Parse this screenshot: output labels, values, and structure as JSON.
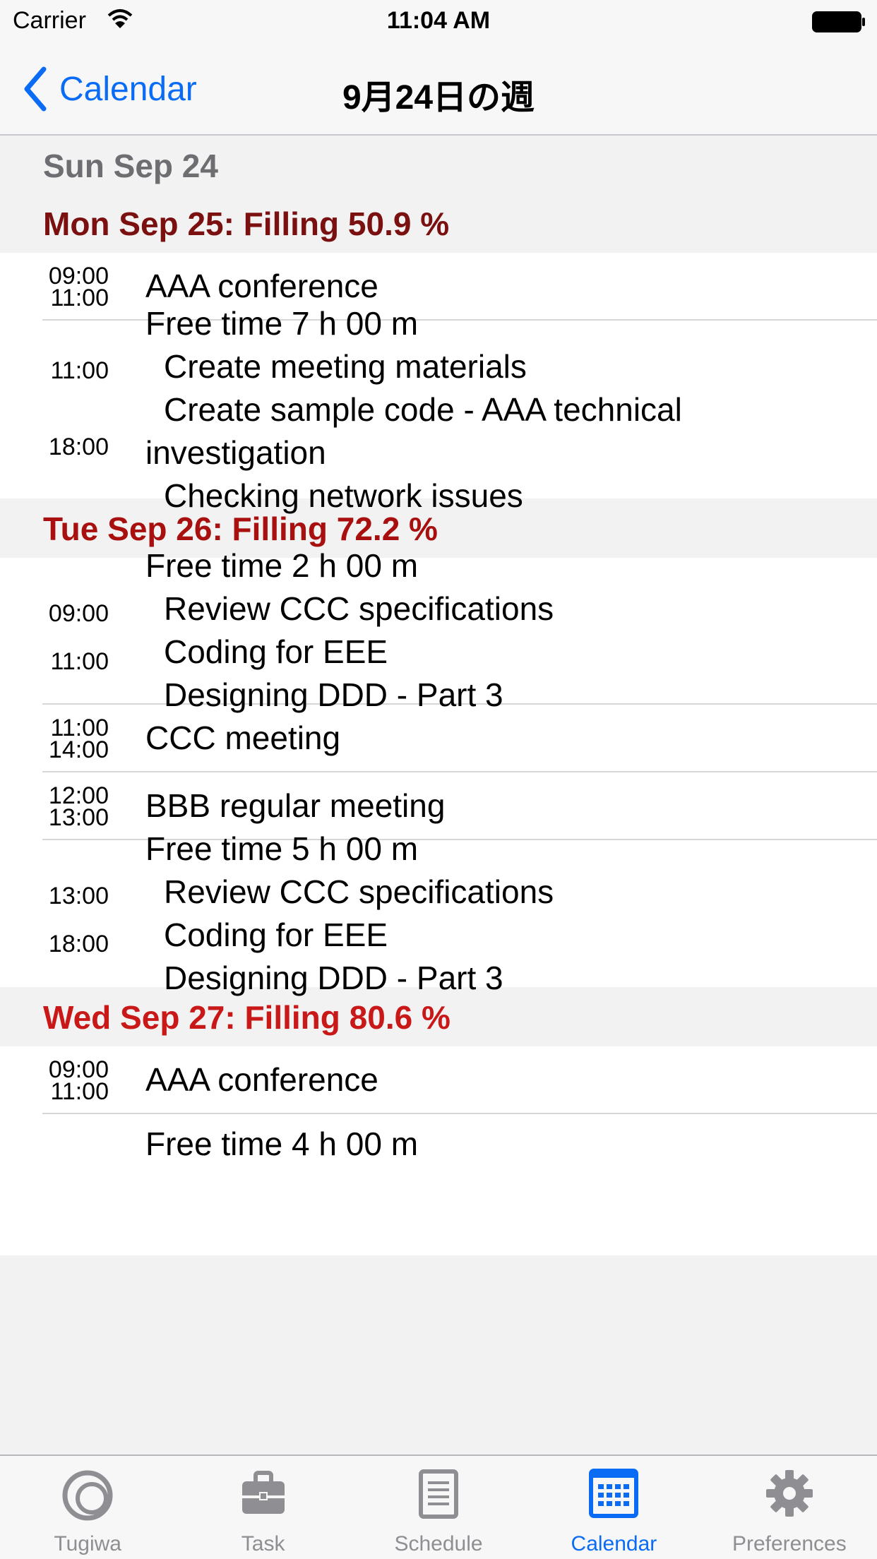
{
  "status_bar": {
    "carrier": "Carrier",
    "time": "11:04 AM"
  },
  "nav": {
    "back_label": "Calendar",
    "title": "9月24日の週"
  },
  "colors": {
    "accent": "#0a6cf5",
    "fill_50": "#7a1010",
    "fill_72": "#a81010",
    "fill_80": "#c81818",
    "plain_day": "#6d6d72"
  },
  "days": [
    {
      "header": "Sun Sep 24",
      "color": "#6d6d72",
      "rows": []
    },
    {
      "header": "Mon Sep 25: Filling 50.9 %",
      "color": "#7a1010",
      "rows": [
        {
          "start": "09:00",
          "end": "11:00",
          "title": "AAA conference",
          "items": []
        },
        {
          "start": "11:00",
          "end": "18:00",
          "title": "Free time 7 h 00 m",
          "items": [
            "Create meeting materials",
            "Create sample code - AAA technical",
            "investigation",
            "Checking network issues"
          ]
        }
      ]
    },
    {
      "header": "Tue Sep 26: Filling 72.2 %",
      "color": "#a81010",
      "rows": [
        {
          "start": "09:00",
          "end": "11:00",
          "title": "Free time 2 h 00 m",
          "items": [
            "Review CCC specifications",
            "Coding for EEE",
            "Designing DDD - Part 3"
          ]
        },
        {
          "start": "11:00",
          "end": "14:00",
          "title": "CCC meeting",
          "items": []
        },
        {
          "start": "12:00",
          "end": "13:00",
          "title": "BBB regular meeting",
          "items": []
        },
        {
          "start": "13:00",
          "end": "18:00",
          "title": "Free time 5 h 00 m",
          "items": [
            "Review CCC specifications",
            "Coding for EEE",
            "Designing DDD - Part 3"
          ]
        }
      ]
    },
    {
      "header": "Wed Sep 27: Filling 80.6 %",
      "color": "#c81818",
      "rows": [
        {
          "start": "09:00",
          "end": "11:00",
          "title": "AAA conference",
          "items": []
        },
        {
          "start": "",
          "end": "",
          "title": "Free time 4 h 00 m",
          "items": []
        }
      ]
    }
  ],
  "tabs": [
    {
      "label": "Tugiwa",
      "icon": "rings-icon",
      "active": false
    },
    {
      "label": "Task",
      "icon": "briefcase-icon",
      "active": false
    },
    {
      "label": "Schedule",
      "icon": "document-icon",
      "active": false
    },
    {
      "label": "Calendar",
      "icon": "calendar-grid-icon",
      "active": true
    },
    {
      "label": "Preferences",
      "icon": "gear-icon",
      "active": false
    }
  ]
}
